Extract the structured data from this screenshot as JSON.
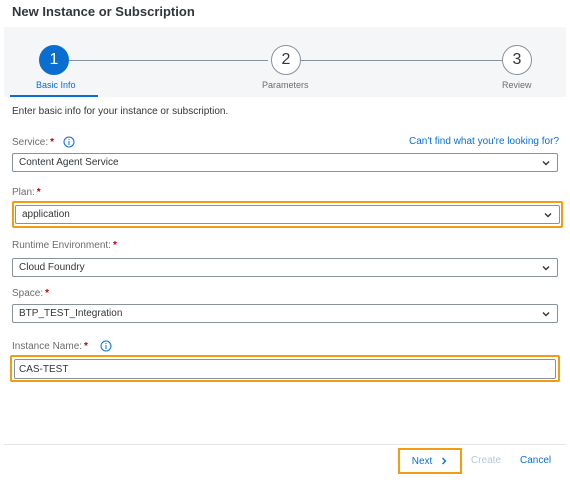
{
  "dialog": {
    "title": "New Instance or Subscription"
  },
  "steps": [
    {
      "number": "1",
      "label": "Basic Info",
      "active": true
    },
    {
      "number": "2",
      "label": "Parameters",
      "active": false
    },
    {
      "number": "3",
      "label": "Review",
      "active": false
    }
  ],
  "intro": "Enter basic info for your instance or subscription.",
  "form": {
    "required_mark": "*",
    "service": {
      "label": "Service:",
      "value": "Content Agent Service",
      "help_link": "Can't find what you're looking for?"
    },
    "plan": {
      "label": "Plan:",
      "value": "application"
    },
    "runtime": {
      "label": "Runtime Environment:",
      "value": "Cloud Foundry"
    },
    "space": {
      "label": "Space:",
      "value": "BTP_TEST_Integration"
    },
    "instance_name": {
      "label": "Instance Name:",
      "value": "CAS-TEST"
    }
  },
  "footer": {
    "next": "Next",
    "create": "Create",
    "cancel": "Cancel"
  },
  "colors": {
    "accent": "#0a6ed1",
    "highlight": "#f39c12",
    "required": "#bb0000"
  }
}
